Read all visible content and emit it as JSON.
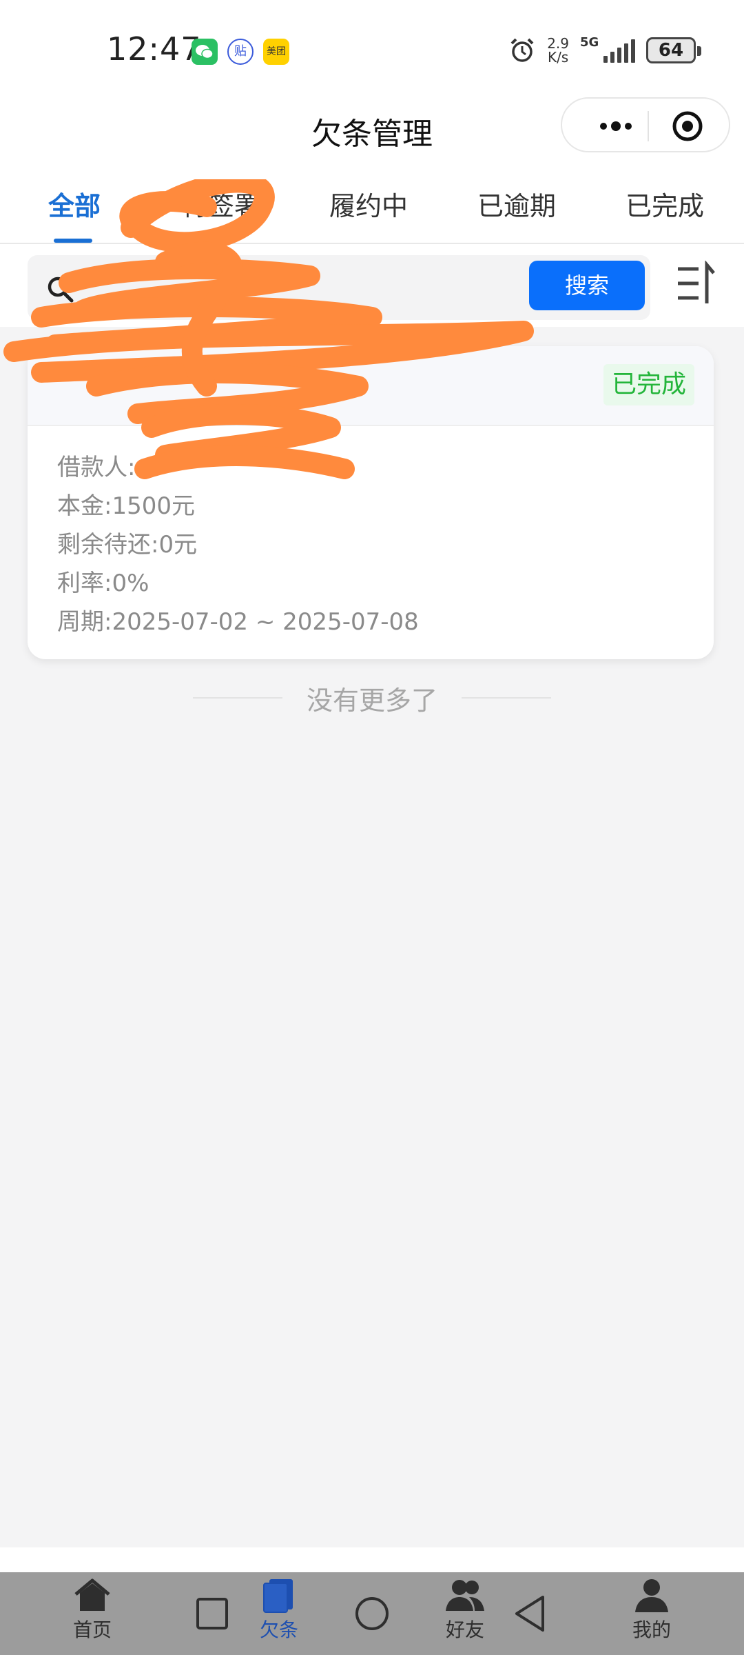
{
  "status_bar": {
    "time": "12:47",
    "apps": [
      "wechat-icon",
      "tieba-icon",
      "meituan-icon"
    ],
    "tieba_glyph": "贴",
    "meituan_glyph": "美团",
    "net_speed_value": "2.9",
    "net_speed_unit": "K/s",
    "network": "5G",
    "battery": "64"
  },
  "nav": {
    "title": "欠条管理"
  },
  "tabs": [
    {
      "label": "全部",
      "active": true
    },
    {
      "label": "待签署",
      "active": false
    },
    {
      "label": "履约中",
      "active": false
    },
    {
      "label": "已逾期",
      "active": false
    },
    {
      "label": "已完成",
      "active": false
    }
  ],
  "search": {
    "placeholder": "",
    "button_label": "搜索"
  },
  "loans": [
    {
      "title": "",
      "status": "已完成",
      "borrower_label": "借款人:",
      "borrower": "",
      "principal_label": "本金:",
      "principal": "1500元",
      "remaining_label": "剩余待还:",
      "remaining": "0元",
      "rate_label": "利率:",
      "rate": "0%",
      "period_label": "周期:",
      "period": "2025-07-02 ~ 2025-07-08"
    }
  ],
  "list_end_text": "没有更多了",
  "tabbar": [
    {
      "label": "首页",
      "icon": "home-icon",
      "active": false
    },
    {
      "label": "欠条",
      "icon": "document-icon",
      "active": true
    },
    {
      "label": "好友",
      "icon": "friends-icon",
      "active": false
    },
    {
      "label": "我的",
      "icon": "user-icon",
      "active": false
    }
  ],
  "colors": {
    "accent": "#1a6fd4",
    "search_button": "#0a6ffb",
    "completed": "#23b53a",
    "redaction": "#ff8a3d"
  }
}
